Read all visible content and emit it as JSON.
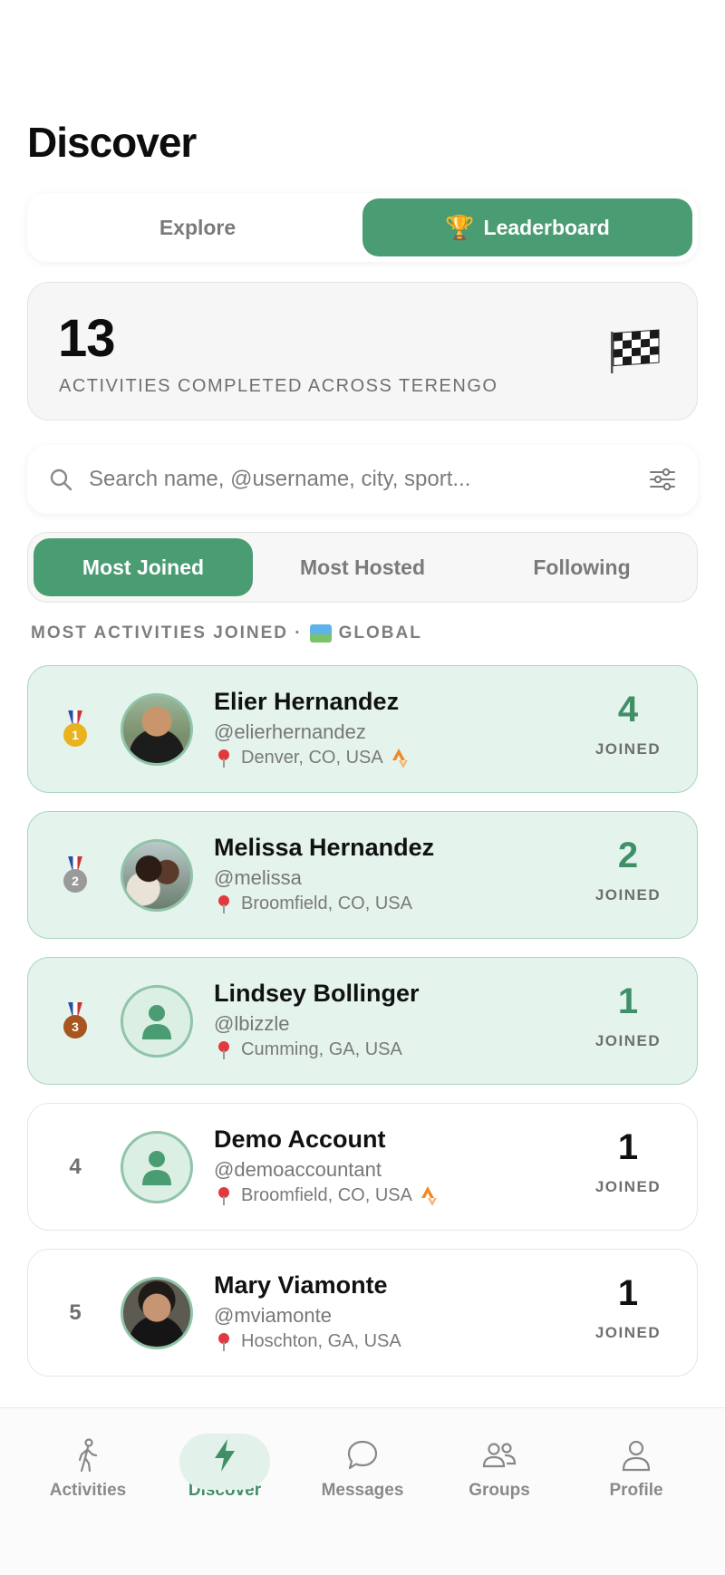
{
  "header": {
    "title": "Discover"
  },
  "main_tabs": [
    {
      "label": "Explore",
      "active": false
    },
    {
      "label": "Leaderboard",
      "icon": "trophy-icon",
      "active": true
    }
  ],
  "stats": {
    "count": "13",
    "label": "ACTIVITIES COMPLETED ACROSS TERENGO",
    "icon": "checkered-flag-icon"
  },
  "search": {
    "placeholder": "Search name, @username, city, sport...",
    "value": ""
  },
  "sub_tabs": [
    {
      "label": "Most Joined",
      "active": true
    },
    {
      "label": "Most Hosted",
      "active": false
    },
    {
      "label": "Following",
      "active": false
    }
  ],
  "section": {
    "label_left": "MOST ACTIVITIES JOINED ·",
    "label_right": "GLOBAL",
    "icon": "globe-map-icon"
  },
  "leaderboard": [
    {
      "rank": "1",
      "medal": "gold",
      "name": "Elier Hernandez",
      "handle": "@elierhernandez",
      "location": "Denver, CO, USA",
      "strava": true,
      "count": "4",
      "unit": "JOINED"
    },
    {
      "rank": "2",
      "medal": "silver",
      "name": "Melissa Hernandez",
      "handle": "@melissa",
      "location": "Broomfield, CO, USA",
      "strava": false,
      "count": "2",
      "unit": "JOINED"
    },
    {
      "rank": "3",
      "medal": "bronze",
      "name": "Lindsey Bollinger",
      "handle": "@lbizzle",
      "location": "Cumming, GA, USA",
      "strava": false,
      "count": "1",
      "unit": "JOINED"
    },
    {
      "rank": "4",
      "medal": "",
      "name": "Demo Account",
      "handle": "@demoaccountant",
      "location": "Broomfield, CO, USA",
      "strava": true,
      "count": "1",
      "unit": "JOINED"
    },
    {
      "rank": "5",
      "medal": "",
      "name": "Mary Viamonte",
      "handle": "@mviamonte",
      "location": "Hoschton, GA, USA",
      "strava": false,
      "count": "1",
      "unit": "JOINED"
    }
  ],
  "tabbar": [
    {
      "label": "Activities",
      "icon": "walking-person-icon",
      "active": false
    },
    {
      "label": "Discover",
      "icon": "lightning-bolt-icon",
      "active": true
    },
    {
      "label": "Messages",
      "icon": "chat-bubble-icon",
      "active": false
    },
    {
      "label": "Groups",
      "icon": "people-icon",
      "active": false
    },
    {
      "label": "Profile",
      "icon": "person-icon",
      "active": false
    }
  ],
  "colors": {
    "accent": "#4a9c72",
    "highlight_row": "#e4f3ec",
    "strava": "#f08a24"
  }
}
